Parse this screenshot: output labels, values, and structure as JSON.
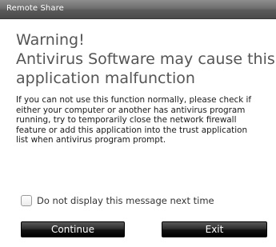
{
  "window": {
    "title": "Remote Share"
  },
  "dialog": {
    "heading_lines": [
      "Warning!",
      "Antivirus Software may cause this",
      "application malfunction"
    ],
    "body_lines": [
      "If you can not use this function normally, please check if",
      "either your computer or another has antivirus program",
      "running, try to temporarily close the network firewall",
      "feature or add this application into the trust application",
      "list when antivirus program prompt."
    ],
    "checkbox": {
      "label": "Do not display this message next time",
      "checked": false
    },
    "buttons": {
      "continue_label": "Continue",
      "exit_label": "Exit"
    }
  },
  "colors": {
    "titlebar": "#6e6e6e",
    "heading_text": "#555555",
    "body_text": "#1a1a1a",
    "button_bg": "#1a1a1a",
    "button_text": "#ffffff"
  }
}
